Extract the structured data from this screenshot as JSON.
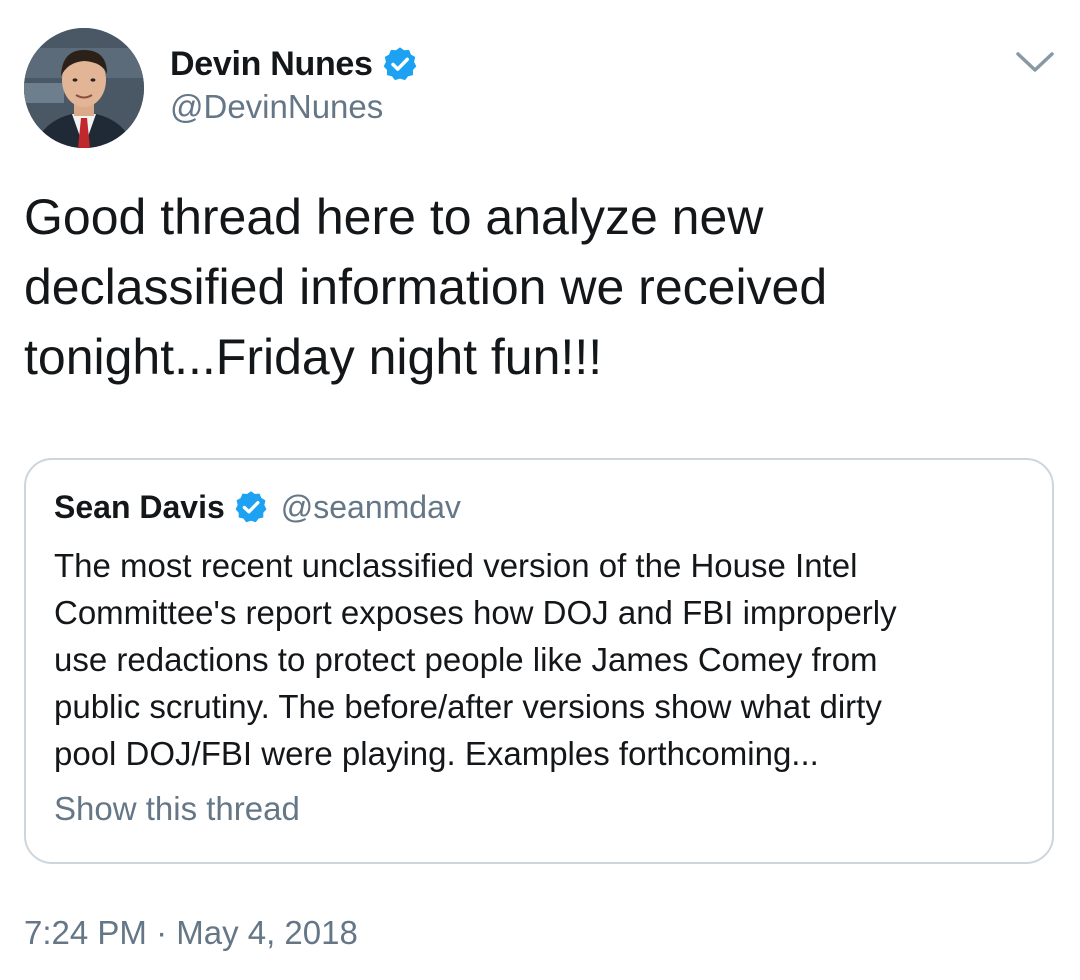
{
  "author": {
    "name": "Devin Nunes",
    "handle": "@DevinNunes",
    "verified": true
  },
  "tweet": {
    "text": "Good thread here to analyze new\ndeclassified information we received\ntonight...Friday night fun!!!",
    "timestamp": "7:24 PM · May 4, 2018"
  },
  "quote": {
    "name": "Sean Davis",
    "handle": "@seanmdav",
    "verified": true,
    "text": "The most recent unclassified version of the House Intel\nCommittee's report exposes how DOJ and FBI improperly\nuse redactions to protect people like James Comey from\npublic scrutiny. The before/after versions show what dirty\npool DOJ/FBI were playing. Examples forthcoming...",
    "show_thread_label": "Show this thread"
  },
  "icons": {
    "verified": "verified-badge-icon",
    "menu": "chevron-down-icon"
  },
  "colors": {
    "verified_blue": "#1da1f2",
    "secondary_text": "#657786",
    "primary_text": "#14171a",
    "border": "#ccd6dd"
  }
}
